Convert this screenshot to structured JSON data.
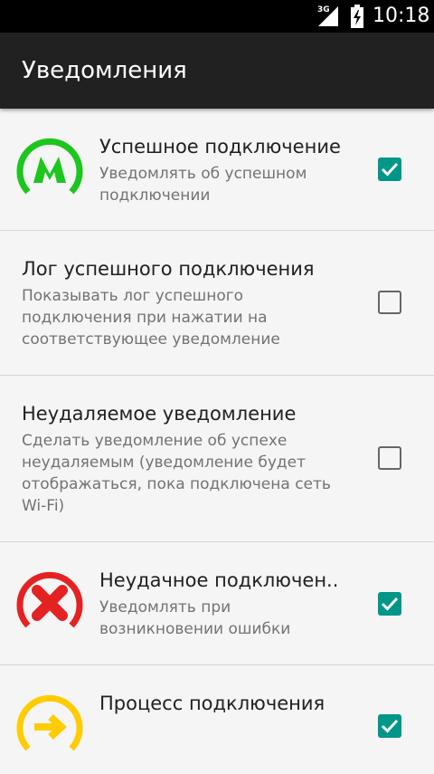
{
  "status_bar": {
    "network": "3G",
    "time": "10:18",
    "icons": [
      "signal-icon",
      "battery-charging-icon"
    ]
  },
  "toolbar": {
    "title": "Уведомления"
  },
  "colors": {
    "accent": "#009688",
    "success": "#1cc61c",
    "error": "#e52222",
    "progress": "#ffcc00",
    "toolbar": "#212121"
  },
  "preferences": [
    {
      "title": "Успешное подключение",
      "summary": "Уведомлять об успешном подключении",
      "icon": "metro-success-icon",
      "checked": true
    },
    {
      "title": "Лог успешного подключения",
      "summary": "Показывать лог успешного подключения при нажатии на соответствующее уведомление",
      "checked": false
    },
    {
      "title": "Неудаляемое уведомление",
      "summary": "Сделать уведомление об успехе неудаляемым (уведомление будет отображаться, пока подключена сеть Wi-Fi)",
      "checked": false
    },
    {
      "title": "Неудачное подключен..",
      "summary": "Уведомлять при возникновении ошибки",
      "icon": "error-cross-icon",
      "checked": true
    },
    {
      "title": "Процесс подключения",
      "summary": "",
      "icon": "progress-arrow-icon",
      "checked": true
    }
  ]
}
